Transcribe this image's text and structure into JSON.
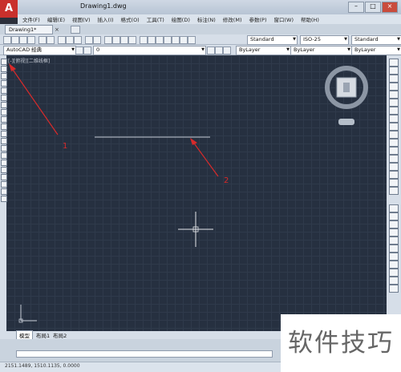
{
  "window": {
    "title": "Drawing1.dwg",
    "app_logo": "A"
  },
  "menu": [
    "文件(F)",
    "编辑(E)",
    "视图(V)",
    "插入(I)",
    "格式(O)",
    "工具(T)",
    "绘图(D)",
    "标注(N)",
    "修改(M)",
    "参数(P)",
    "窗口(W)",
    "帮助(H)"
  ],
  "tab": {
    "doc_label": "Drawing1*",
    "close_glyph": "×"
  },
  "toolbar": {
    "text_style": "Standard",
    "dim_style": "ISO-25",
    "table_style": "Standard",
    "workspace": "AutoCAD 经典",
    "layer": "0",
    "color": "ByLayer",
    "linetype": "ByLayer",
    "lineweight": "ByLayer"
  },
  "viewport": {
    "label": "[-][俯视][二维线框]"
  },
  "annotations": {
    "label1": "1",
    "label2": "2"
  },
  "layout_tabs": [
    "模型",
    "布局1",
    "布局2"
  ],
  "status": {
    "coords": "2151.1489, 1510.1135, 0.0000"
  },
  "watermark": "软件技巧",
  "colors": {
    "canvas": "#263040",
    "annotation": "#d92a2a",
    "drawn_line": "#c8ced8"
  }
}
